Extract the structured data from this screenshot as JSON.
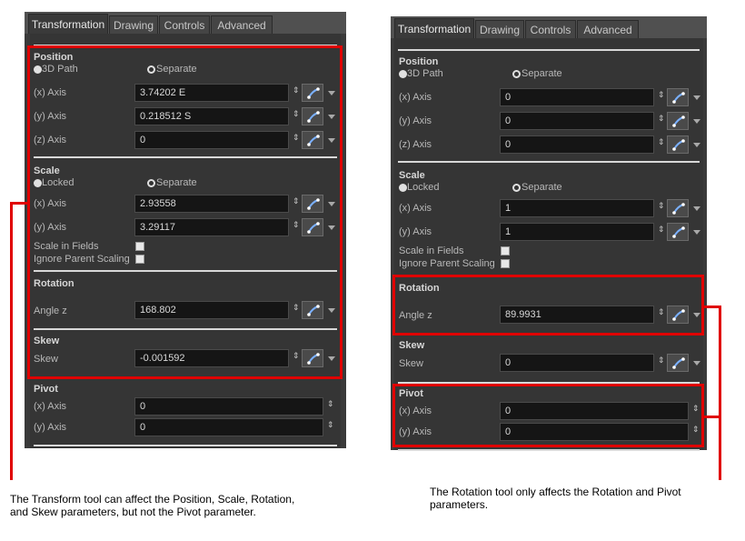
{
  "left_panel": {
    "tabs": [
      "Transformation",
      "Drawing",
      "Controls",
      "Advanced"
    ],
    "active_tab": "Transformation",
    "position": {
      "title": "Position",
      "opt1": "3D Path",
      "opt2": "Separate",
      "x_label": "(x) Axis",
      "x_value": "3.74202 E",
      "y_label": "(y) Axis",
      "y_value": "0.218512 S",
      "z_label": "(z) Axis",
      "z_value": "0"
    },
    "scale": {
      "title": "Scale",
      "opt1": "Locked",
      "opt2": "Separate",
      "x_label": "(x) Axis",
      "x_value": "2.93558",
      "y_label": "(y) Axis",
      "y_value": "3.29117",
      "fields_label": "Scale in Fields",
      "ignore_label": "Ignore Parent Scaling"
    },
    "rotation": {
      "title": "Rotation",
      "angle_label": "Angle z",
      "angle_value": "168.802"
    },
    "skew": {
      "title": "Skew",
      "label": "Skew",
      "value": "-0.001592"
    },
    "pivot": {
      "title": "Pivot",
      "x_label": "(x) Axis",
      "x_value": "0",
      "y_label": "(y) Axis",
      "y_value": "0"
    }
  },
  "right_panel": {
    "tabs": [
      "Transformation",
      "Drawing",
      "Controls",
      "Advanced"
    ],
    "active_tab": "Transformation",
    "position": {
      "title": "Position",
      "opt1": "3D Path",
      "opt2": "Separate",
      "x_label": "(x) Axis",
      "x_value": "0",
      "y_label": "(y) Axis",
      "y_value": "0",
      "z_label": "(z) Axis",
      "z_value": "0"
    },
    "scale": {
      "title": "Scale",
      "opt1": "Locked",
      "opt2": "Separate",
      "x_label": "(x) Axis",
      "x_value": "1",
      "y_label": "(y) Axis",
      "y_value": "1",
      "fields_label": "Scale in Fields",
      "ignore_label": "Ignore Parent Scaling"
    },
    "rotation": {
      "title": "Rotation",
      "angle_label": "Angle z",
      "angle_value": "89.9931"
    },
    "skew": {
      "title": "Skew",
      "label": "Skew",
      "value": "0"
    },
    "pivot": {
      "title": "Pivot",
      "x_label": "(x) Axis",
      "x_value": "0",
      "y_label": "(y) Axis",
      "y_value": "0"
    }
  },
  "captions": {
    "left": [
      "The Transform tool can affect the Position, Scale, Rotation,",
      "and Skew parameters, but not the Pivot parameter."
    ],
    "right": [
      "The Rotation tool only affects the Rotation and Pivot",
      "parameters."
    ]
  },
  "icons": {
    "spin": "spin-arrows-icon",
    "function": "function-curve-icon",
    "dropdown": "dropdown-arrow-icon"
  },
  "colors": {
    "highlight": "#e00000",
    "panel_bg": "#353535",
    "field_bg": "#151515"
  }
}
